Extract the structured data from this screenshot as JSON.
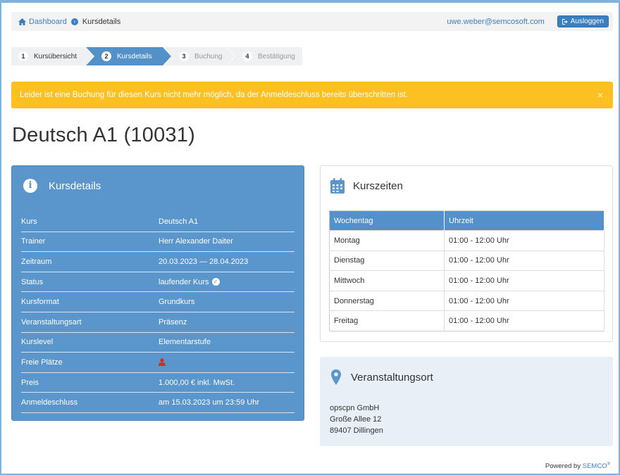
{
  "breadcrumb": {
    "home": "Dashboard",
    "current": "Kursdetails"
  },
  "user": {
    "email": "uwe.weber@semcosoft.com",
    "logout_label": "Ausloggen"
  },
  "steps": [
    {
      "num": "1",
      "label": "Kursübersicht",
      "state": "done"
    },
    {
      "num": "2",
      "label": "Kursdetails",
      "state": "active"
    },
    {
      "num": "3",
      "label": "Buchung",
      "state": "pending"
    },
    {
      "num": "4",
      "label": "Bestätigung",
      "state": "pending"
    }
  ],
  "alert": {
    "text": "Leider ist eine Buchung für diesen Kurs nicht mehr möglich, da der Anmeldeschluss bereits überschritten ist.",
    "close": "×"
  },
  "title": "Deutsch A1 (10031)",
  "details": {
    "title": "Kursdetails",
    "rows": [
      {
        "key": "Kurs",
        "value": "Deutsch A1"
      },
      {
        "key": "Trainer",
        "value": "Herr Alexander Daiter"
      },
      {
        "key": "Zeitraum",
        "value": "20.03.2023 — 28.04.2023"
      },
      {
        "key": "Status",
        "value": "laufender Kurs"
      },
      {
        "key": "Kursformat",
        "value": "Grundkurs"
      },
      {
        "key": "Veranstaltungsart",
        "value": "Präsenz"
      },
      {
        "key": "Kurslevel",
        "value": "Elementarstufe"
      },
      {
        "key": "Freie Plätze",
        "value": ""
      },
      {
        "key": "Preis",
        "value": "1.000,00 € inkl. MwSt."
      },
      {
        "key": "Anmeldeschluss",
        "value": "am 15.03.2023 um 23:59 Uhr"
      }
    ]
  },
  "schedule": {
    "title": "Kurszeiten",
    "headers": [
      "Wochentag",
      "Uhrzeit"
    ],
    "rows": [
      [
        "Montag",
        "01:00 - 12:00 Uhr"
      ],
      [
        "Dienstag",
        "01:00 - 12:00 Uhr"
      ],
      [
        "Mittwoch",
        "01:00 - 12:00 Uhr"
      ],
      [
        "Donnerstag",
        "01:00 - 12:00 Uhr"
      ],
      [
        "Freitag",
        "01:00 - 12:00 Uhr"
      ]
    ]
  },
  "location": {
    "title": "Veranstaltungsort",
    "lines": [
      "opscpn GmbH",
      "Große Allee 12",
      "89407 Dillingen"
    ]
  },
  "footer": {
    "prefix": "Powered by",
    "brand": "SEMCO",
    "reg": "®"
  },
  "colors": {
    "primary": "#5a95cb",
    "alert": "#fcc120",
    "link": "#3a7fc1",
    "seat_icon": "#c9302c"
  }
}
